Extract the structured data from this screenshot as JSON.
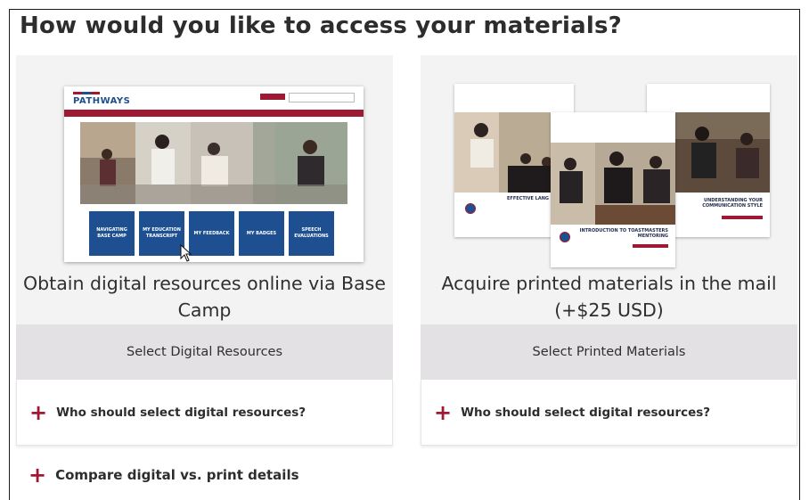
{
  "page": {
    "title": "How would you like to access your materials?"
  },
  "cards": [
    {
      "heading": "Obtain digital resources online via Base Camp",
      "select_label": "Select Digital Resources",
      "faq_label": "Who should select digital resources?",
      "preview": {
        "logo_text": "PATHWAYS",
        "tiles": [
          "NAVIGATING BASE CAMP",
          "MY EDUCATION TRANSCRIPT",
          "MY FEEDBACK",
          "MY BADGES",
          "SPEECH EVALUATIONS"
        ]
      }
    },
    {
      "heading": "Acquire printed materials in the mail (+$25 USD)",
      "select_label": "Select Printed Materials",
      "faq_label": "Who should select digital resources?",
      "preview": {
        "book_titles": [
          "EFFECTIVE LANG",
          "INTRODUCTION TO TOASTMASTERS MENTORING",
          "UNDERSTANDING YOUR COMMUNICATION STYLE"
        ]
      }
    }
  ],
  "compare": {
    "label": "Compare digital vs. print details"
  },
  "icons": {
    "plus": "plus-icon",
    "cursor": "mouse-pointer-icon"
  },
  "colors": {
    "accent": "#9e1a32",
    "brand_blue": "#1d4f91",
    "card_bg": "#f3f3f4",
    "select_bar_bg": "#e3e1e3"
  }
}
